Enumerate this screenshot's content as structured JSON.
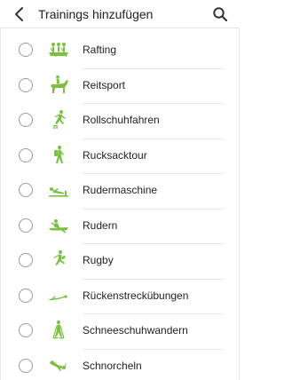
{
  "header": {
    "title": "Trainings hinzufügen",
    "back_icon": "back-arrow-icon",
    "search_icon": "search-icon"
  },
  "colors": {
    "icon_green": "#7ac142",
    "radio_border": "#9a9a9a",
    "divider": "#e8e8e8"
  },
  "items": [
    {
      "label": "Rafting",
      "icon": "rafting-icon",
      "selected": false
    },
    {
      "label": "Reitsport",
      "icon": "horse-riding-icon",
      "selected": false
    },
    {
      "label": "Rollschuhfahren",
      "icon": "roller-skating-icon",
      "selected": false
    },
    {
      "label": "Rucksacktour",
      "icon": "backpacking-icon",
      "selected": false
    },
    {
      "label": "Rudermaschine",
      "icon": "rowing-machine-icon",
      "selected": false
    },
    {
      "label": "Rudern",
      "icon": "rowing-icon",
      "selected": false
    },
    {
      "label": "Rugby",
      "icon": "rugby-icon",
      "selected": false
    },
    {
      "label": "Rückenstreckübungen",
      "icon": "back-extension-icon",
      "selected": false
    },
    {
      "label": "Schneeschuhwandern",
      "icon": "snowshoeing-icon",
      "selected": false
    },
    {
      "label": "Schnorcheln",
      "icon": "snorkeling-icon",
      "selected": false
    }
  ]
}
